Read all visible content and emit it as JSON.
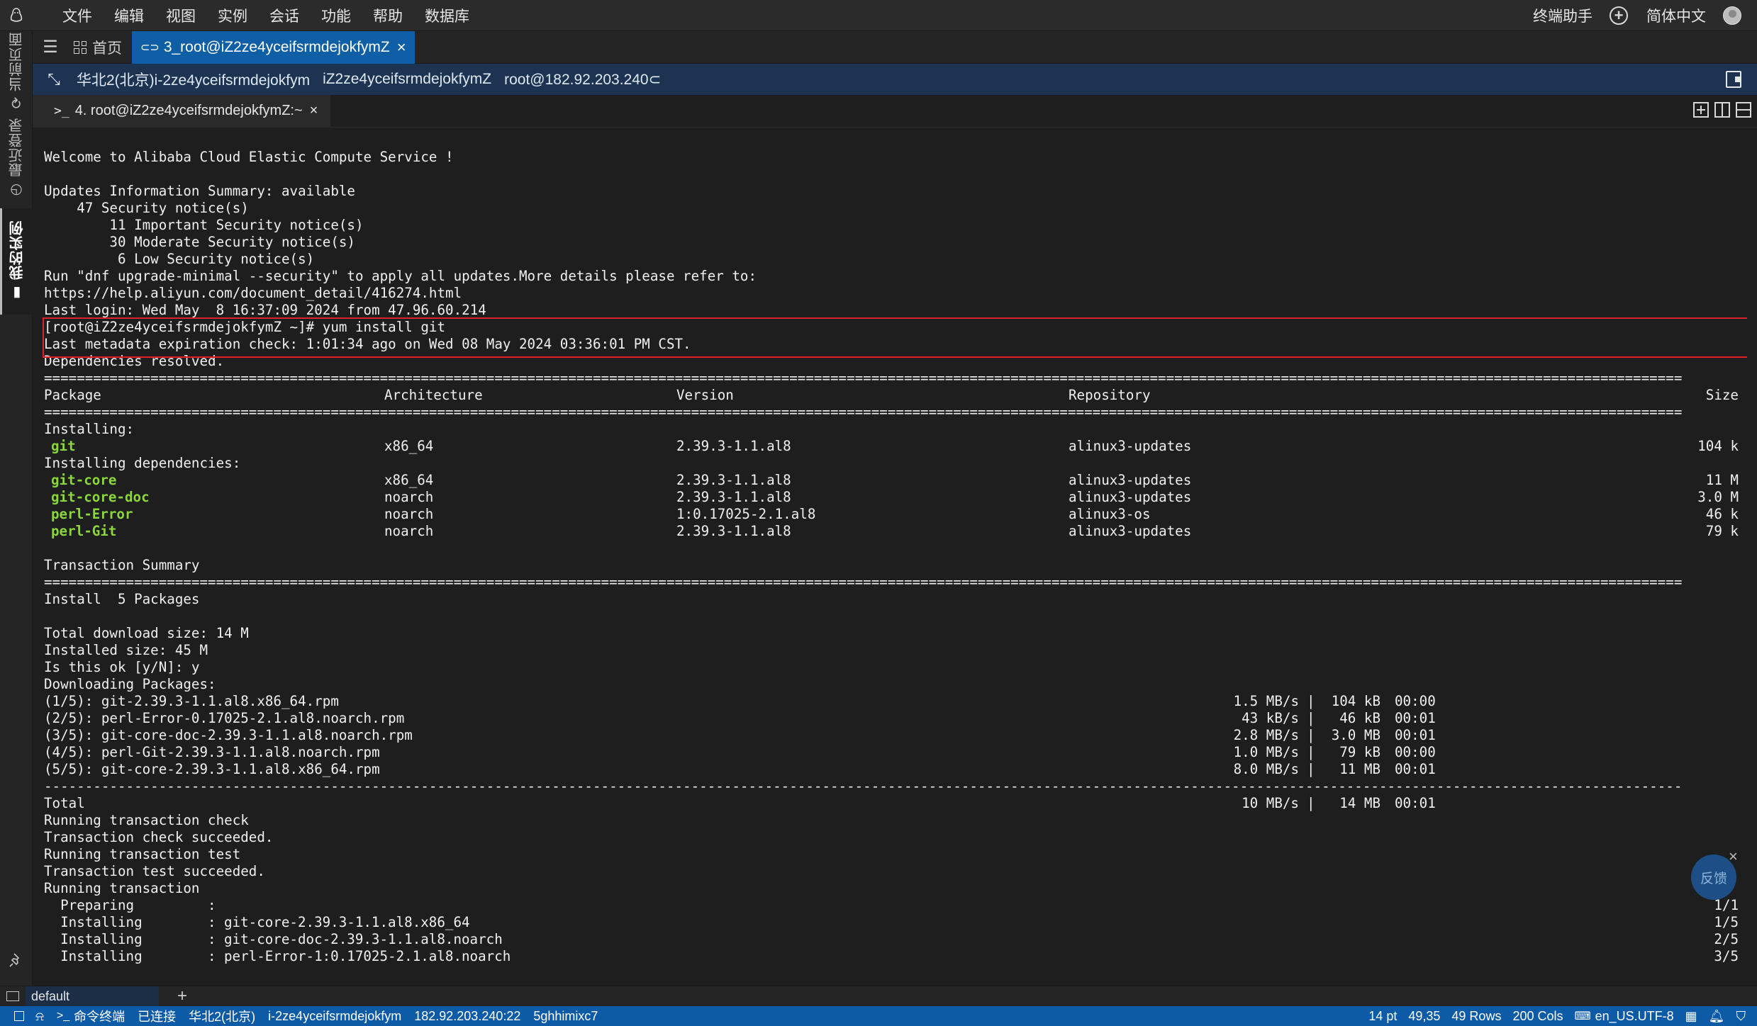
{
  "menubar": {
    "items": [
      "文件",
      "编辑",
      "视图",
      "实例",
      "会话",
      "功能",
      "帮助",
      "数据库"
    ],
    "terminal_assistant": "终端助手",
    "language": "简体中文"
  },
  "sidebar": {
    "tabs": [
      {
        "label": "当前页面",
        "icon": "refresh-icon"
      },
      {
        "label": "最近登录",
        "icon": "clock-icon"
      },
      {
        "label": "我的实例",
        "icon": "instance-icon"
      }
    ]
  },
  "tabbar": {
    "home_label": "首页",
    "session_label": "3_root@iZ2ze4yceifsrmdejokfymZ"
  },
  "infobar": {
    "region": "华北2(北京)i-2ze4yceifsrmdejokfym",
    "hostname": "iZ2ze4yceifsrmdejokfymZ",
    "user_host": "root@182.92.203.240"
  },
  "terminal_tab": {
    "label": "4. root@iZ2ze4yceifsrmdejokfymZ:~"
  },
  "terminal": {
    "lines": [
      "Welcome to Alibaba Cloud Elastic Compute Service !",
      "",
      "Updates Information Summary: available",
      "    47 Security notice(s)",
      "        11 Important Security notice(s)",
      "        30 Moderate Security notice(s)",
      "         6 Low Security notice(s)",
      "Run \"dnf upgrade-minimal --security\" to apply all updates.More details please refer to:",
      "https://help.aliyun.com/document_detail/416274.html",
      "Last login: Wed May  8 16:37:09 2024 from 47.96.60.214",
      "[root@iZ2ze4yceifsrmdejokfymZ ~]# yum install git",
      "Last metadata expiration check: 1:01:34 ago on Wed 08 May 2024 03:36:01 PM CST.",
      "Dependencies resolved."
    ],
    "table_header": {
      "package": "Package",
      "arch": "Architecture",
      "version": "Version",
      "repo": "Repository",
      "size": "Size"
    },
    "installing_label": "Installing:",
    "installing": [
      {
        "package": "git",
        "arch": "x86_64",
        "version": "2.39.3-1.1.al8",
        "repo": "alinux3-updates",
        "size": "104 k"
      }
    ],
    "deps_label": "Installing dependencies:",
    "dependencies": [
      {
        "package": "git-core",
        "arch": "x86_64",
        "version": "2.39.3-1.1.al8",
        "repo": "alinux3-updates",
        "size": "11 M"
      },
      {
        "package": "git-core-doc",
        "arch": "noarch",
        "version": "2.39.3-1.1.al8",
        "repo": "alinux3-updates",
        "size": "3.0 M"
      },
      {
        "package": "perl-Error",
        "arch": "noarch",
        "version": "1:0.17025-2.1.al8",
        "repo": "alinux3-os",
        "size": "46 k"
      },
      {
        "package": "perl-Git",
        "arch": "noarch",
        "version": "2.39.3-1.1.al8",
        "repo": "alinux3-updates",
        "size": "79 k"
      }
    ],
    "summary_label": "Transaction Summary",
    "install_summary": "Install  5 Packages",
    "post_summary": [
      "",
      "Total download size: 14 M",
      "Installed size: 45 M",
      "Is this ok [y/N]: y",
      "Downloading Packages:"
    ],
    "downloads": [
      {
        "name": "(1/5): git-2.39.3-1.1.al8.x86_64.rpm",
        "speed": "1.5 MB/s",
        "size": "104 kB",
        "time": "00:00"
      },
      {
        "name": "(2/5): perl-Error-0.17025-2.1.al8.noarch.rpm",
        "speed": "43 kB/s",
        "size": "46 kB",
        "time": "00:01"
      },
      {
        "name": "(3/5): git-core-doc-2.39.3-1.1.al8.noarch.rpm",
        "speed": "2.8 MB/s",
        "size": "3.0 MB",
        "time": "00:01"
      },
      {
        "name": "(4/5): perl-Git-2.39.3-1.1.al8.noarch.rpm",
        "speed": "1.0 MB/s",
        "size": "79 kB",
        "time": "00:00"
      },
      {
        "name": "(5/5): git-core-2.39.3-1.1.al8.x86_64.rpm",
        "speed": "8.0 MB/s",
        "size": "11 MB",
        "time": "00:01"
      }
    ],
    "total": {
      "name": "Total",
      "speed": "10 MB/s",
      "size": "14 MB",
      "time": "00:01"
    },
    "transaction_lines": [
      "Running transaction check",
      "Transaction check succeeded.",
      "Running transaction test",
      "Transaction test succeeded.",
      "Running transaction"
    ],
    "steps": [
      {
        "action": "  Preparing",
        "target": "",
        "progress": "1/1"
      },
      {
        "action": "  Installing",
        "target": "git-core-2.39.3-1.1.al8.x86_64",
        "progress": "1/5"
      },
      {
        "action": "  Installing",
        "target": "git-core-doc-2.39.3-1.1.al8.noarch",
        "progress": "2/5"
      },
      {
        "action": "  Installing",
        "target": "perl-Error-1:0.17025-2.1.al8.noarch",
        "progress": "3/5"
      }
    ]
  },
  "feedback": {
    "label": "反馈"
  },
  "sessionbar": {
    "tab_label": "default"
  },
  "statusbar": {
    "cmd_terminal": "命令终端",
    "connected": "已连接",
    "region": "华北2(北京)",
    "instance_id": "i-2ze4yceifsrmdejokfym",
    "address": "182.92.203.240:22",
    "session_code": "5ghhimixc7",
    "font_size": "14 pt",
    "cursor": "49,35",
    "rows": "49 Rows",
    "cols": "200 Cols",
    "encoding": "en_US.UTF-8"
  },
  "colors": {
    "accent": "#0f5fa6",
    "infobar": "#1c3352",
    "package_green": "#8bd63a",
    "highlight_red": "#e0202a",
    "terminal_bg": "#1e1e1e"
  }
}
